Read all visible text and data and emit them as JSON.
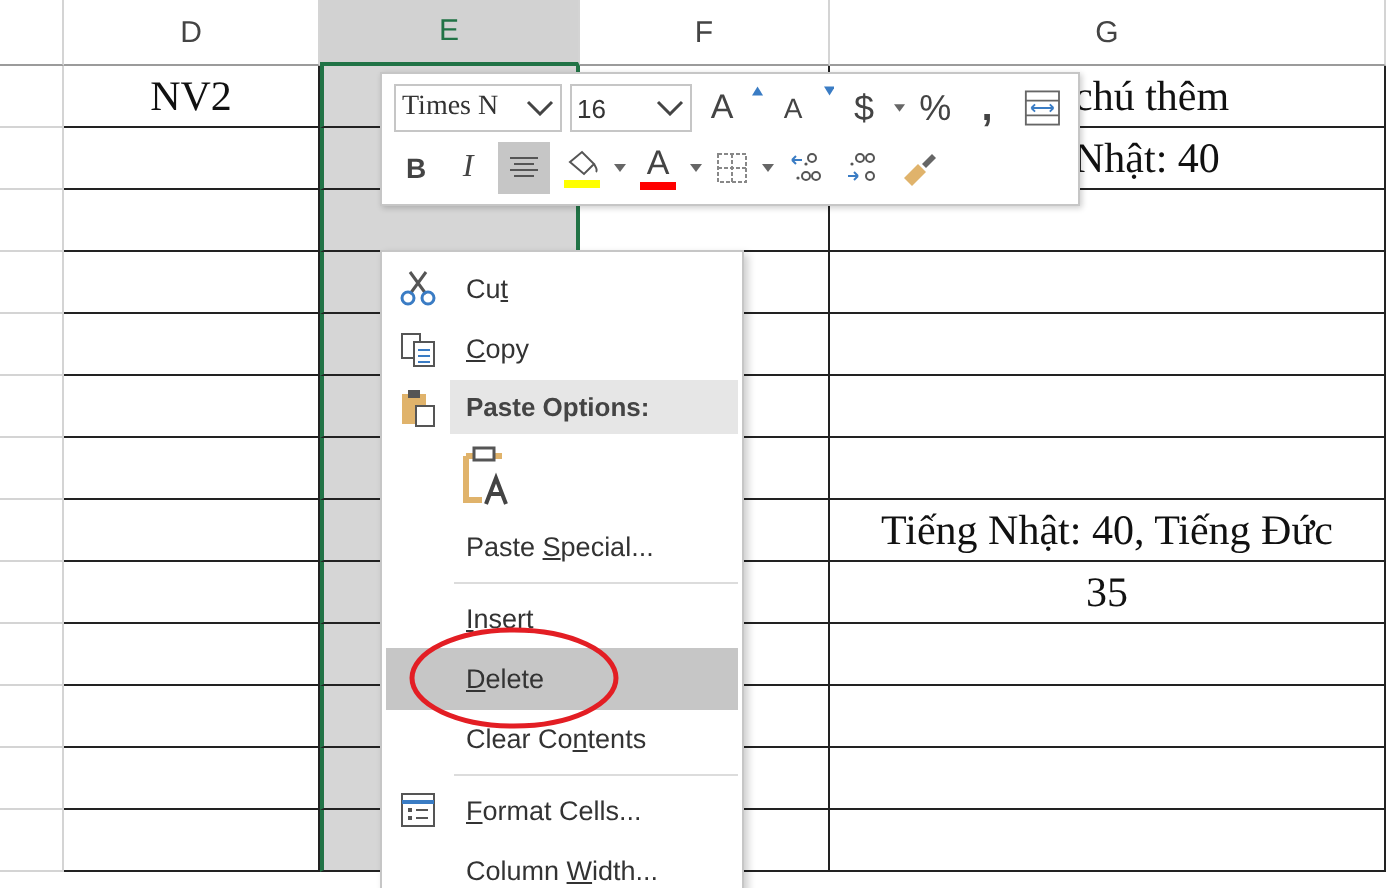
{
  "columns": [
    {
      "label": "D",
      "selected": false
    },
    {
      "label": "E",
      "selected": true
    },
    {
      "label": "F",
      "selected": false
    },
    {
      "label": "G",
      "selected": false
    }
  ],
  "rows": [
    [
      "NV2",
      null,
      null,
      "chú thêm"
    ],
    [
      null,
      null,
      null,
      "Nhật: 40"
    ],
    [
      null,
      null,
      null,
      null
    ],
    [
      null,
      null,
      null,
      null
    ],
    [
      null,
      null,
      null,
      null
    ],
    [
      null,
      null,
      null,
      null
    ],
    [
      null,
      null,
      null,
      null
    ],
    [
      null,
      null,
      null,
      "Tiếng Nhật: 40, Tiếng Đức"
    ],
    [
      null,
      null,
      null,
      "35"
    ],
    [
      null,
      null,
      null,
      null
    ],
    [
      null,
      null,
      null,
      null
    ],
    [
      null,
      null,
      null,
      null
    ],
    [
      null,
      null,
      null,
      null
    ]
  ],
  "mini_toolbar": {
    "font": "Times N",
    "size": "16",
    "row_1": [
      {
        "kind": "grow",
        "text": "A"
      },
      {
        "kind": "shrink",
        "text": "A"
      },
      {
        "kind": "currency",
        "text": "$"
      },
      {
        "kind": "percent",
        "text": "%"
      },
      {
        "kind": "comma",
        "text": ","
      },
      {
        "kind": "wrap"
      }
    ],
    "row_2": [
      {
        "kind": "bold",
        "text": "B",
        "selected": false
      },
      {
        "kind": "italic",
        "text": "I",
        "selected": false
      },
      {
        "kind": "center",
        "selected": true
      },
      {
        "kind": "fill",
        "color": "#ffff00"
      },
      {
        "kind": "fontcolor",
        "text": "A",
        "color": "#ff0000"
      },
      {
        "kind": "borders"
      },
      {
        "kind": "increase"
      },
      {
        "kind": "decrease"
      },
      {
        "kind": "painter"
      }
    ]
  },
  "context_menu": {
    "items": [
      {
        "kind": "cut",
        "before": "Cu",
        "key": "t",
        "selected": false
      },
      {
        "kind": "copy",
        "key": "C",
        "after": "opy",
        "selected": false
      },
      {
        "kind": "paste_heading",
        "label": "Paste Options:"
      },
      {
        "kind": "paste_option"
      },
      {
        "kind": "plain",
        "before": "Paste ",
        "key": "S",
        "after": "pecial...",
        "selected": false
      },
      {
        "kind": "separator"
      },
      {
        "kind": "plain",
        "key": "I",
        "after": "nsert",
        "selected": false
      },
      {
        "kind": "plain",
        "key": "D",
        "after": "elete",
        "selected": true
      },
      {
        "kind": "plain",
        "before": "Clear Co",
        "key": "n",
        "after": "tents",
        "selected": false
      },
      {
        "kind": "separator"
      },
      {
        "kind": "format",
        "key": "F",
        "after": "ormat Cells...",
        "selected": false
      },
      {
        "kind": "plain",
        "before": "Column ",
        "key": "W",
        "after": "idth...",
        "selected": false
      }
    ]
  },
  "annotation": {
    "kind": "ellipse",
    "color": "#e31e24"
  }
}
